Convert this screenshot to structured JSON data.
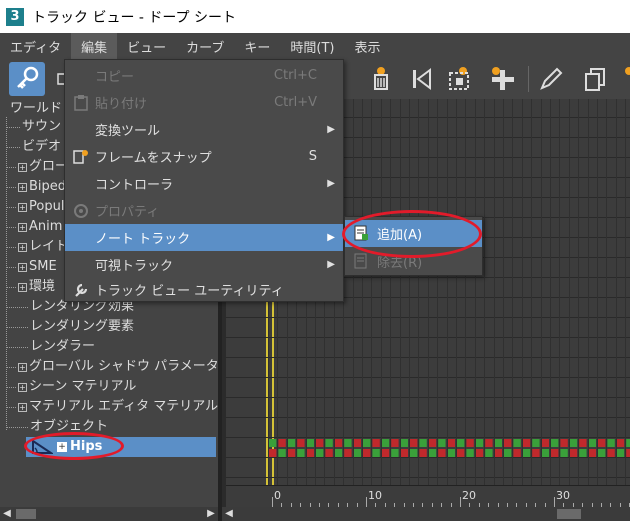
{
  "window": {
    "title": "トラック ビュー - ドープ シート",
    "app_icon_text": "3"
  },
  "menubar": {
    "items": [
      {
        "label": "エディタ"
      },
      {
        "label": "編集"
      },
      {
        "label": "ビュー"
      },
      {
        "label": "カーブ"
      },
      {
        "label": "キー"
      },
      {
        "label": "時間(T)"
      },
      {
        "label": "表示"
      }
    ]
  },
  "edit_menu": {
    "items": [
      {
        "label": "コピー",
        "shortcut": "Ctrl+C",
        "disabled": true
      },
      {
        "label": "貼り付け",
        "shortcut": "Ctrl+V",
        "disabled": true
      },
      {
        "label": "変換ツール",
        "submenu": true
      },
      {
        "label": "フレームをスナップ",
        "shortcut": "S"
      },
      {
        "label": "コントローラ",
        "submenu": true
      },
      {
        "label": "プロパティ",
        "disabled": true
      },
      {
        "label": "ノート トラック",
        "submenu": true,
        "highlighted": true
      },
      {
        "label": "可視トラック",
        "submenu": true
      },
      {
        "label": "トラック ビュー ユーティリティ"
      }
    ]
  },
  "note_track_submenu": {
    "items": [
      {
        "label": "追加(A)",
        "highlighted": true
      },
      {
        "label": "除去(R)",
        "disabled": true
      }
    ]
  },
  "tree": {
    "root": "ワールド",
    "items": [
      {
        "label": "サウン",
        "expand": false
      },
      {
        "label": "ビデオ",
        "expand": false
      },
      {
        "label": "グロー",
        "expand": true
      },
      {
        "label": "Biped",
        "expand": true
      },
      {
        "label": "Popul",
        "expand": true
      },
      {
        "label": "Anim",
        "expand": true
      },
      {
        "label": "レイト",
        "expand": true
      },
      {
        "label": "SME",
        "expand": true
      },
      {
        "label": "環境",
        "expand": true
      },
      {
        "label": "レンダリング効果",
        "expand": false
      },
      {
        "label": "レンダリング要素",
        "expand": false
      },
      {
        "label": "レンダラー",
        "expand": false
      },
      {
        "label": "グローバル シャドウ パラメータ",
        "expand": true
      },
      {
        "label": "シーン マテリアル",
        "expand": true
      },
      {
        "label": "マテリアル エディタ マテリアル",
        "expand": true
      },
      {
        "label": "オブジェクト",
        "expand": false
      }
    ],
    "selected": {
      "label": "Hips"
    }
  },
  "ruler": {
    "labels": [
      "0",
      "10",
      "20",
      "30"
    ]
  },
  "colors": {
    "selection": "#5b8fc7",
    "key_red": "#c0292c",
    "key_green": "#3aa03a",
    "annotation": "#e21b2a",
    "time_slider": "#d4c237"
  },
  "icons": {
    "toolbar": [
      "key-filter-icon",
      "delete-keys-icon",
      "go-to-start-icon",
      "select-keys-icon",
      "add-keys-icon",
      "pencil-icon",
      "copy-icon"
    ],
    "menu": [
      "copy-icon",
      "paste-icon",
      "snap-frames-icon",
      "properties-icon",
      "wrench-icon"
    ],
    "submenu": [
      "add-note-icon",
      "remove-note-icon"
    ]
  }
}
